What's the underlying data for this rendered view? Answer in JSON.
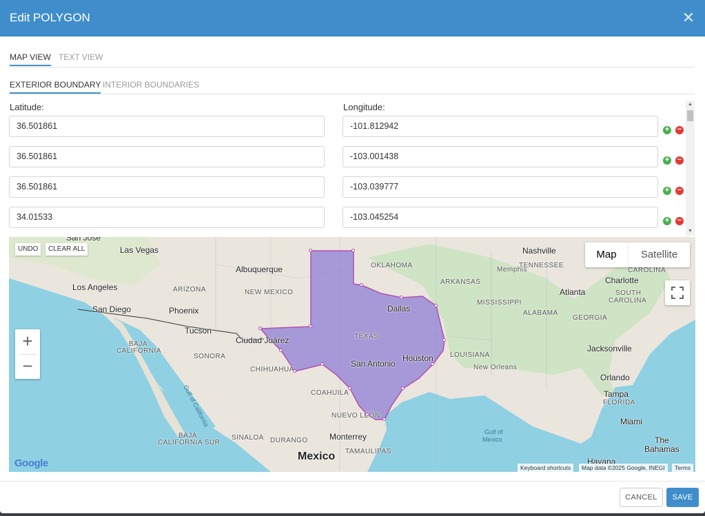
{
  "dialog": {
    "title": "Edit POLYGON"
  },
  "tabs": [
    {
      "label": "MAP VIEW"
    },
    {
      "label": "TEXT VIEW"
    }
  ],
  "subtabs": [
    {
      "label": "EXTERIOR BOUNDARY"
    },
    {
      "label": "INTERIOR BOUNDARIES"
    }
  ],
  "fields": {
    "latitude_label": "Latitude:",
    "longitude_label": "Longitude:"
  },
  "rows": [
    {
      "lat": "36.501861",
      "lng": "-101.812942"
    },
    {
      "lat": "36.501861",
      "lng": "-103.001438"
    },
    {
      "lat": "36.501861",
      "lng": "-103.039777"
    },
    {
      "lat": "34.01533",
      "lng": "-103.045254"
    }
  ],
  "row_buttons": {
    "add": "+",
    "remove": "−"
  },
  "map": {
    "undo": "UNDO",
    "clear_all": "CLEAR ALL",
    "type_map": "Map",
    "type_satellite": "Satellite",
    "zoom_in": "+",
    "zoom_out": "−",
    "google": "Google",
    "attribution": {
      "shortcuts": "Keyboard shortcuts",
      "data": "Map data ©2025 Google, INEGI",
      "terms": "Terms"
    },
    "polygon_fill": "#8e7fd6",
    "polygon_stroke": "#b44fb0",
    "labels": {
      "san_jose": "San Jose",
      "las_vegas": "Las Vegas",
      "albuquerque": "Albuquerque",
      "oklahoma": "OKLAHOMA",
      "nashville": "Nashville",
      "memphis": "Memphis",
      "tennessee": "TENNESSEE",
      "carolina": "CAROLINA",
      "los_angeles": "Los Angeles",
      "arizona": "ARIZONA",
      "new_mexico": "NEW MEXICO",
      "arkansas": "ARKANSAS",
      "atlanta": "Atlanta",
      "charlotte": "Charlotte",
      "south_carolina_1": "SOUTH",
      "south_carolina_2": "CAROLINA",
      "mississippi": "MISSISSIPPI",
      "san_diego": "San Diego",
      "phoenix": "Phoenix",
      "dallas": "Dallas",
      "alabama": "ALABAMA",
      "georgia": "GEORGIA",
      "tucson": "Tucson",
      "texas": "TEXAS",
      "baja_california_1": "BAJA",
      "baja_california_2": "CALIFORNIA",
      "ciudad_juarez": "Ciudad Juárez",
      "jacksonville": "Jacksonville",
      "sonora": "SONORA",
      "houston": "Houston",
      "louisiana": "LOUISIANA",
      "san_antonio": "San Antonio",
      "new_orleans": "New Orleans",
      "chihuahua": "CHIHUAHUA",
      "orlando": "Orlando",
      "coahuila": "COAHUILA",
      "tampa": "Tampa",
      "florida": "FLORIDA",
      "gulf_of_california": "Gulf of California",
      "nuevo_leon": "NUEVO LEÓN",
      "miami": "Miami",
      "baja_california_sur_1": "BAJA",
      "baja_california_sur_2": "CALIFORNIA SUR",
      "sinaloa": "SINALOA",
      "durango": "DURANGO",
      "monterrey": "Monterrey",
      "gulf_of_mexico_1": "Gulf of",
      "gulf_of_mexico_2": "Mexico",
      "the_bahamas_1": "The",
      "the_bahamas_2": "Bahamas",
      "tamaulipas": "TAMAULIPAS",
      "mexico": "Mexico",
      "havana": "Havana"
    }
  },
  "footer": {
    "cancel": "CANCEL",
    "save": "SAVE"
  }
}
